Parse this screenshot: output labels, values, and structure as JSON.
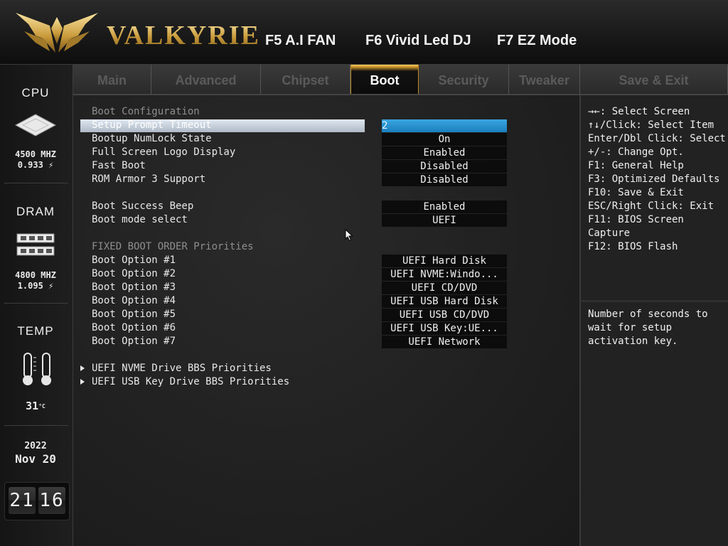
{
  "header": {
    "brand": "VALKYRIE",
    "fkeys": [
      "F5 A.I FAN",
      "F6 Vivid Led DJ",
      "F7 EZ Mode"
    ]
  },
  "tabs": [
    "Main",
    "Advanced",
    "Chipset",
    "Boot",
    "Security",
    "Tweaker",
    "Save & Exit"
  ],
  "active_tab": "Boot",
  "sidebar": {
    "cpu_title": "CPU",
    "cpu_freq": "4500 MHZ",
    "cpu_volt": "0.933",
    "dram_title": "DRAM",
    "dram_freq": "4800 MHZ",
    "dram_volt": "1.095",
    "temp_title": "TEMP",
    "temp_value": "31",
    "temp_unit": "°C",
    "year": "2022",
    "month_day": "Nov 20",
    "clock_hours": "21",
    "clock_minutes": "16"
  },
  "settings": [
    {
      "label": "Boot Configuration",
      "section": true
    },
    {
      "label": "Setup Prompt Timeout",
      "value": "2",
      "selected": true
    },
    {
      "label": "Bootup NumLock State",
      "value": "On"
    },
    {
      "label": "Full Screen Logo Display",
      "value": "Enabled"
    },
    {
      "label": "Fast Boot",
      "value": "Disabled"
    },
    {
      "label": "ROM Armor 3 Support",
      "value": "Disabled"
    },
    {
      "label": "Boot Success Beep",
      "value": "Enabled"
    },
    {
      "label": "Boot mode select",
      "value": "UEFI"
    },
    {
      "label": "FIXED BOOT ORDER Priorities",
      "section": true
    },
    {
      "label": "Boot Option #1",
      "value": "UEFI Hard Disk"
    },
    {
      "label": "Boot Option #2",
      "value": "UEFI NVME:Windo..."
    },
    {
      "label": "Boot Option #3",
      "value": "UEFI CD/DVD"
    },
    {
      "label": "Boot Option #4",
      "value": "UEFI USB Hard Disk"
    },
    {
      "label": "Boot Option #5",
      "value": "UEFI USB CD/DVD"
    },
    {
      "label": "Boot Option #6",
      "value": "UEFI USB Key:UE..."
    },
    {
      "label": "Boot Option #7",
      "value": "UEFI Network"
    },
    {
      "label": "UEFI NVME Drive BBS Priorities",
      "submenu": true
    },
    {
      "label": "UEFI USB Key Drive BBS Priorities",
      "submenu": true
    }
  ],
  "help_keys": [
    "→←: Select Screen",
    "↑↓/Click: Select Item",
    "Enter/Dbl Click: Select",
    "+/-: Change Opt.",
    "F1: General Help",
    "F3: Optimized Defaults",
    "F10: Save & Exit",
    "ESC/Right Click: Exit",
    "F11: BIOS Screen",
    "Capture",
    "F12: BIOS Flash"
  ],
  "item_help": [
    "Number of seconds to",
    "wait for setup",
    "activation key."
  ],
  "colors": {
    "gold": "#d8b760",
    "selection": "#b8c3cf",
    "value_input": "#2a93d0"
  }
}
